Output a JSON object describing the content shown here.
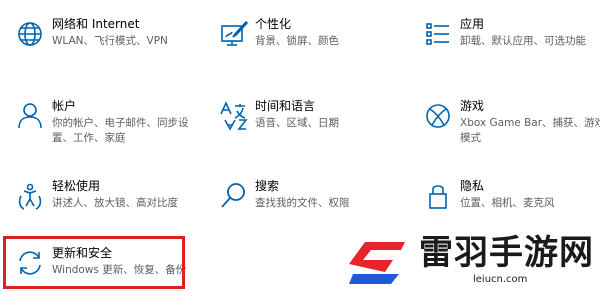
{
  "accent_color": "#0063b1",
  "highlight_color": "#e02020",
  "tiles": [
    {
      "icon": "globe-icon",
      "title": "网络和 Internet",
      "desc": "WLAN、飞行模式、VPN"
    },
    {
      "icon": "personalization-icon",
      "title": "个性化",
      "desc": "背景、锁屏、颜色"
    },
    {
      "icon": "apps-icon",
      "title": "应用",
      "desc": "卸载、默认应用、可选功能"
    },
    {
      "icon": "account-icon",
      "title": "帐户",
      "desc": "你的帐户、电子邮件、同步设置、工作、家庭"
    },
    {
      "icon": "time-language-icon",
      "title": "时间和语言",
      "desc": "语音、区域、日期"
    },
    {
      "icon": "xbox-icon",
      "title": "游戏",
      "desc": "Xbox Game Bar、捕获、游戏模式"
    },
    {
      "icon": "ease-of-access-icon",
      "title": "轻松使用",
      "desc": "讲述人、放大镜、高对比度"
    },
    {
      "icon": "search-icon",
      "title": "搜索",
      "desc": "查找我的文件、权限"
    },
    {
      "icon": "lock-icon",
      "title": "隐私",
      "desc": "位置、相机、麦克风"
    },
    {
      "icon": "update-icon",
      "title": "更新和安全",
      "desc": "Windows 更新、恢复、备份"
    }
  ],
  "watermark": {
    "name": "雷羽手游网",
    "url": "leiucn.com",
    "logo_colors": [
      "#e8242b",
      "#1e5bd8"
    ]
  }
}
